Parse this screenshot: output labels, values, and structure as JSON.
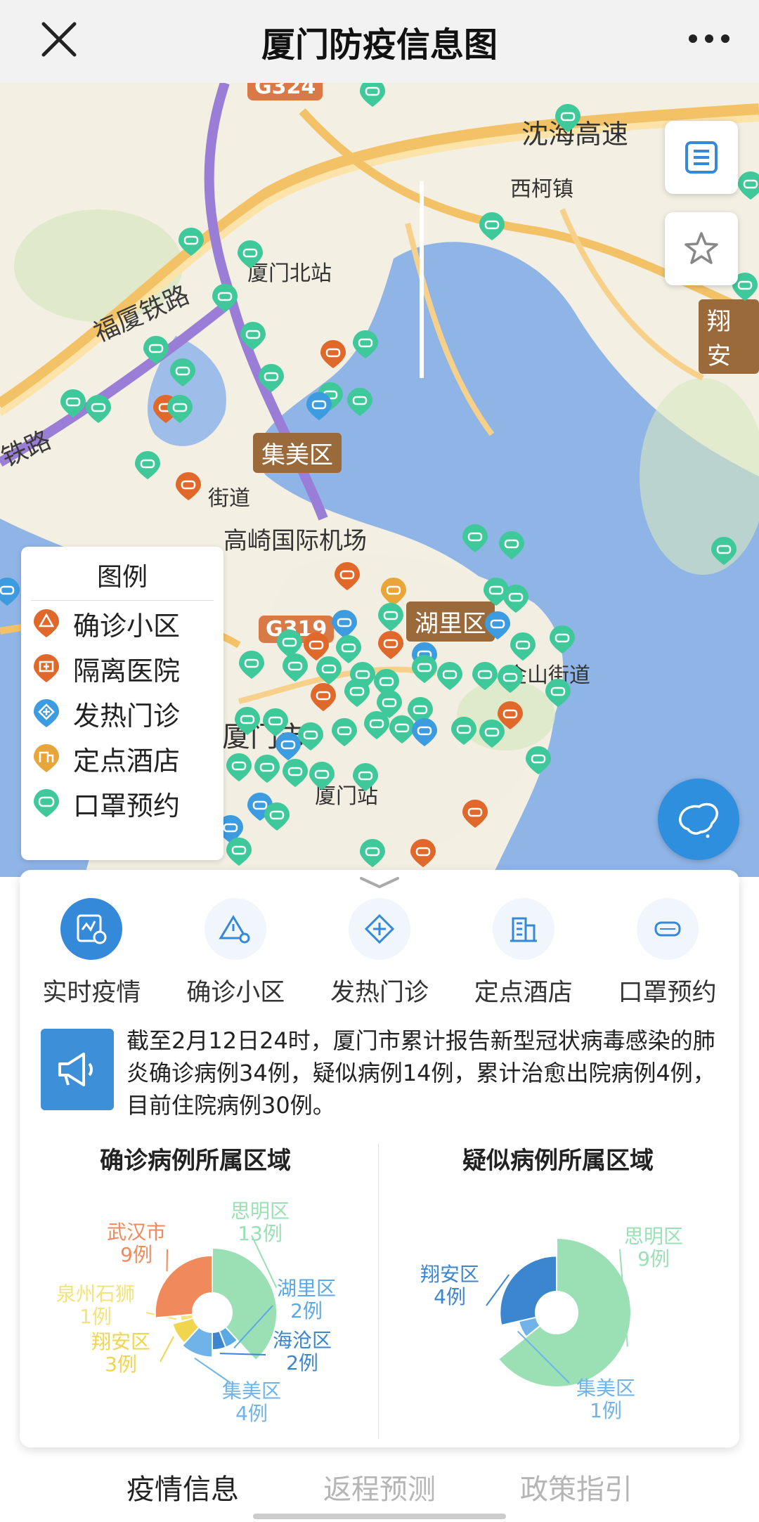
{
  "header": {
    "title": "厦门防疫信息图"
  },
  "map": {
    "labels": {
      "g324": "G324",
      "shenhai": "沈海高速",
      "xike": "西柯镇",
      "xiamen_north": "厦门北站",
      "fuxia_rail": "福厦铁路",
      "rail_left": "铁路",
      "xiangan": "翔安",
      "jimei": "集美区",
      "street": "街道",
      "airport": "高崎国际机场",
      "g319": "G319",
      "huli": "湖里区",
      "jinshan": "金山街道",
      "xiamen_city": "厦门市",
      "xiamen_station": "厦门站"
    }
  },
  "legend": {
    "title": "图例",
    "items": [
      {
        "label": "确诊小区",
        "color": "#e0682a",
        "icon": "warning-marker"
      },
      {
        "label": "隔离医院",
        "color": "#e0682a",
        "icon": "hospital-marker"
      },
      {
        "label": "发热门诊",
        "color": "#3d9be0",
        "icon": "clinic-marker"
      },
      {
        "label": "定点酒店",
        "color": "#e8a53a",
        "icon": "hotel-marker"
      },
      {
        "label": "口罩预约",
        "color": "#3fc99a",
        "icon": "mask-marker"
      }
    ]
  },
  "tabs": [
    {
      "label": "实时疫情",
      "icon": "realtime-icon",
      "active": true
    },
    {
      "label": "确诊小区",
      "icon": "warning-icon",
      "active": false
    },
    {
      "label": "发热门诊",
      "icon": "clinic-icon",
      "active": false
    },
    {
      "label": "定点酒店",
      "icon": "building-icon",
      "active": false
    },
    {
      "label": "口罩预约",
      "icon": "mask-icon",
      "active": false
    }
  ],
  "notice": {
    "text": "截至2月12日24时，厦门市累计报告新型冠状病毒感染的肺炎确诊病例34例，疑似病例14例，累计治愈出院病例4例，目前住院病例30例。"
  },
  "charts": {
    "confirmed_title": "确诊病例所属区域",
    "suspected_title": "疑似病例所属区域"
  },
  "chart_data": [
    {
      "type": "pie",
      "title": "确诊病例所属区域",
      "series": [
        {
          "name": "思明区",
          "value": 13,
          "label": "13例",
          "color": "#9be0b4"
        },
        {
          "name": "湖里区",
          "value": 2,
          "label": "2例",
          "color": "#5aa9e6"
        },
        {
          "name": "海沧区",
          "value": 2,
          "label": "2例",
          "color": "#3c86cf"
        },
        {
          "name": "集美区",
          "value": 4,
          "label": "4例",
          "color": "#6fb3e8"
        },
        {
          "name": "翔安区",
          "value": 3,
          "label": "3例",
          "color": "#f0d54e"
        },
        {
          "name": "泉州石狮",
          "value": 1,
          "label": "1例",
          "color": "#f6e27a"
        },
        {
          "name": "武汉市",
          "value": 9,
          "label": "9例",
          "color": "#f08a5d"
        }
      ]
    },
    {
      "type": "pie",
      "title": "疑似病例所属区域",
      "series": [
        {
          "name": "思明区",
          "value": 9,
          "label": "9例",
          "color": "#9be0b4"
        },
        {
          "name": "集美区",
          "value": 1,
          "label": "1例",
          "color": "#6fb3e8"
        },
        {
          "name": "翔安区",
          "value": 4,
          "label": "4例",
          "color": "#3c86cf"
        }
      ]
    }
  ],
  "bottom_tabs": [
    {
      "label": "疫情信息",
      "active": true
    },
    {
      "label": "返程预测",
      "active": false
    },
    {
      "label": "政策指引",
      "active": false
    }
  ]
}
